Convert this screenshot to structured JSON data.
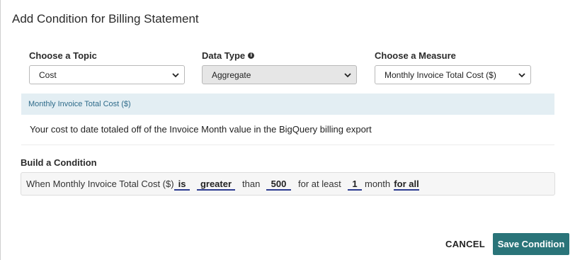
{
  "dialog": {
    "title": "Add Condition for Billing Statement"
  },
  "fields": {
    "topic": {
      "label": "Choose a Topic",
      "value": "Cost"
    },
    "data_type": {
      "label": "Data Type",
      "value": "Aggregate",
      "disabled": true
    },
    "measure": {
      "label": "Choose a Measure",
      "value": "Monthly Invoice Total Cost ($)"
    }
  },
  "measure_info": {
    "name": "Monthly Invoice Total Cost ($)",
    "description": "Your cost to date totaled off of the Invoice Month value in the BigQuery billing export"
  },
  "condition": {
    "label": "Build a Condition",
    "prefix": "When Monthly Invoice Total Cost ($)",
    "operator_is": "is",
    "comparison": "greater",
    "than": "than",
    "threshold": "500",
    "for_at_least": "for at least",
    "duration": "1",
    "unit": "month",
    "scope": "for all"
  },
  "actions": {
    "cancel_label": "CANCEL",
    "save_label": "Save Condition"
  },
  "colors": {
    "primary": "#2a7479",
    "info_bar": "#e3eef3",
    "token_underline": "#2b3a8f"
  },
  "icons": {
    "data_type_info": "info-icon",
    "select_chevron": "chevron-down-icon"
  }
}
